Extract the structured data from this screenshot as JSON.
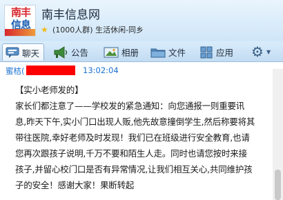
{
  "header": {
    "logo_text_top": "南丰",
    "logo_text_bottom": "信息",
    "group_name": "南丰信息网",
    "member_count": "(1000人群)",
    "category": "生活休闲-同乡"
  },
  "toolbar": {
    "tabs": [
      {
        "label": "聊天",
        "icon": "chat-icon"
      },
      {
        "label": "公告",
        "icon": "megaphone-icon"
      },
      {
        "label": "相册",
        "icon": "photo-album-icon"
      },
      {
        "label": "文件",
        "icon": "folder-icon"
      },
      {
        "label": "应用",
        "icon": "apps-grid-icon"
      }
    ],
    "settings_icon": "gear-icon"
  },
  "chat": {
    "sender_prefix": "蜜桔(",
    "timestamp": "13:02:04",
    "message_lines": [
      "【实小老师发的】",
      "家长们都注意了——学校发的紧急通知：向您通报一则重要讯",
      "息,昨天下午,实小门口出现人贩,他先故意撞倒学生,然后称要将其",
      "带往医院,幸好老师及时发现！我们已在班级进行安全教育,也请",
      "您再次跟孩子说明,千万不要和陌生人走。同时也请您按时来接",
      "孩子,并留心校门口是否有异常情况,让我们相互关心,共同维护孩",
      "子的安全！感谢大家！果断转起"
    ]
  },
  "colors": {
    "accent_blue": "#1a6fcf",
    "redaction": "#ff0000",
    "header_bg": "#cfe6f8"
  }
}
